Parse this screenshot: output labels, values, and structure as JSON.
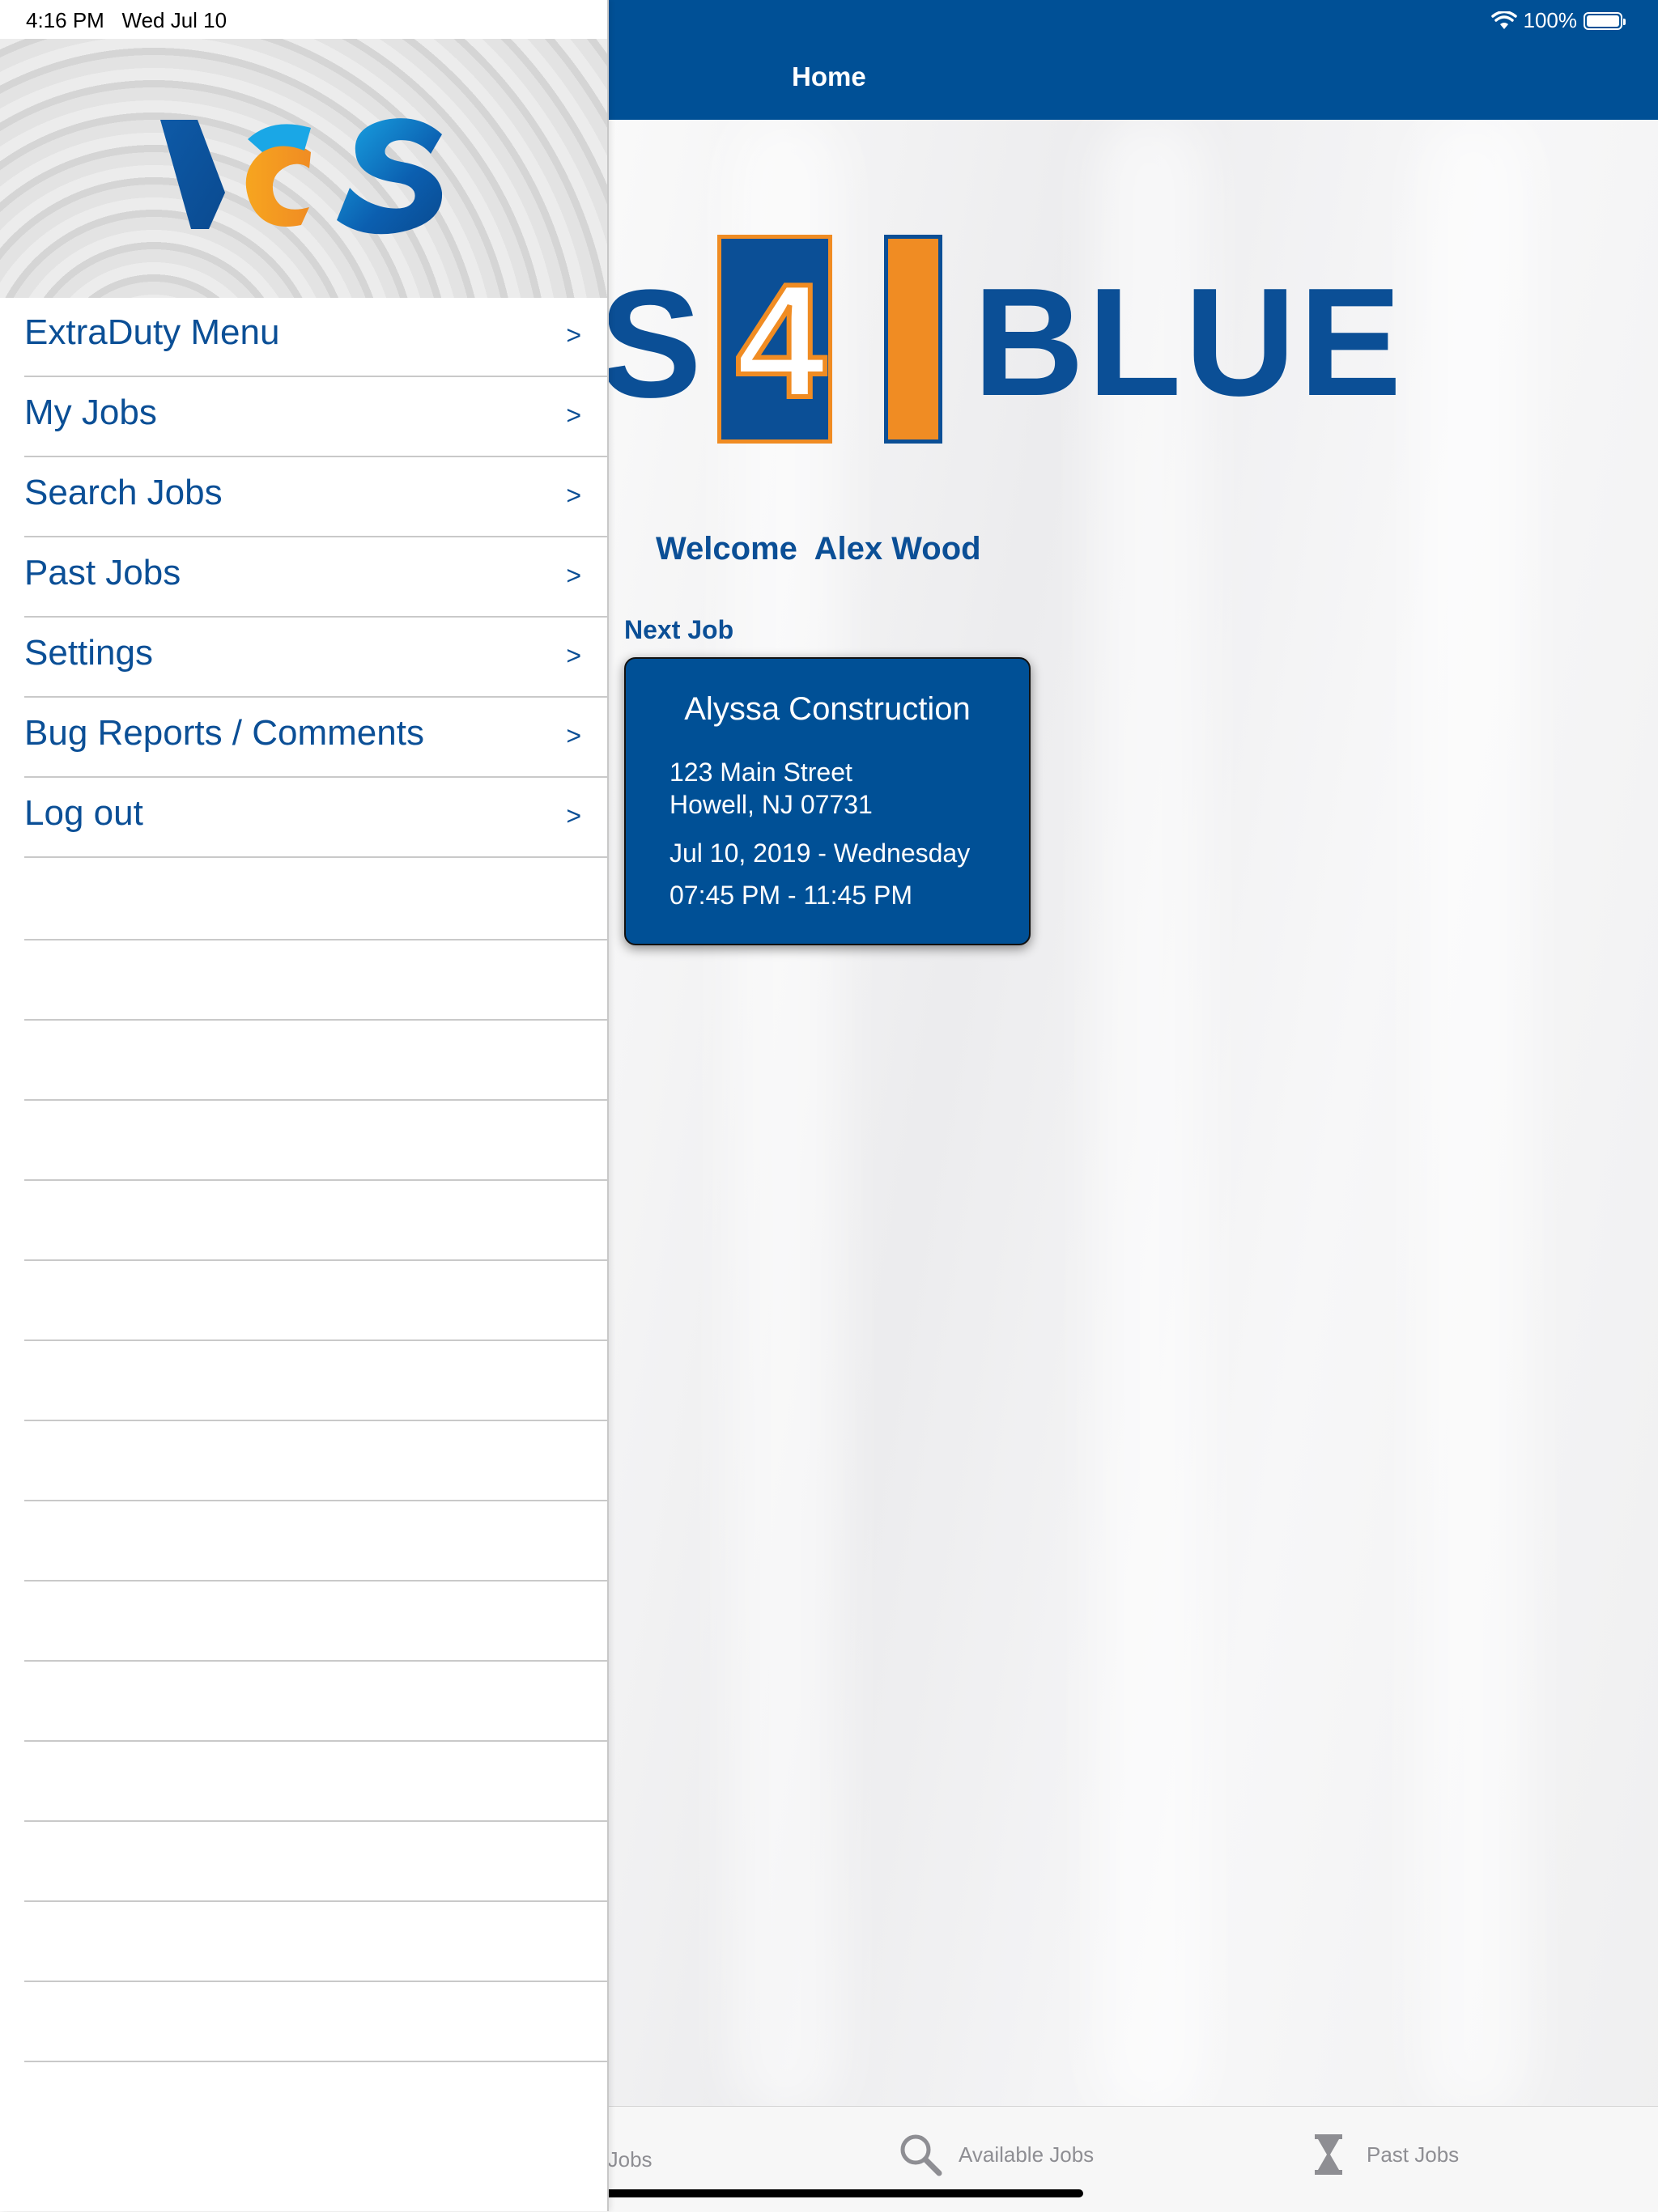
{
  "status_bar": {
    "time": "4:16 PM",
    "date": "Wed Jul 10",
    "battery": "100%"
  },
  "nav": {
    "title": "Home"
  },
  "brand": {
    "s": "S",
    "four": "4",
    "blue": "BLUE"
  },
  "welcome": {
    "greeting": "Welcome",
    "name": "Alex Wood"
  },
  "next_job": {
    "label": "Next Job",
    "company": "Alyssa Construction",
    "address1": "123 Main Street",
    "address2": "Howell, NJ 07731",
    "date": "Jul 10, 2019 - Wednesday",
    "time": "07:45 PM - 11:45 PM"
  },
  "tabs": [
    {
      "label": "ded Jobs",
      "icon": "calendar-icon"
    },
    {
      "label": "Available Jobs",
      "icon": "search-icon"
    },
    {
      "label": "Past Jobs",
      "icon": "hourglass-icon"
    }
  ],
  "drawer": {
    "logo": "VCS",
    "chevron": ">",
    "items": [
      {
        "label": "ExtraDuty Menu"
      },
      {
        "label": "My Jobs"
      },
      {
        "label": "Search Jobs"
      },
      {
        "label": "Past Jobs"
      },
      {
        "label": "Settings"
      },
      {
        "label": "Bug Reports / Comments"
      },
      {
        "label": "Log out"
      }
    ]
  },
  "colors": {
    "brand_blue": "#005096",
    "accent_orange": "#f08c23"
  }
}
